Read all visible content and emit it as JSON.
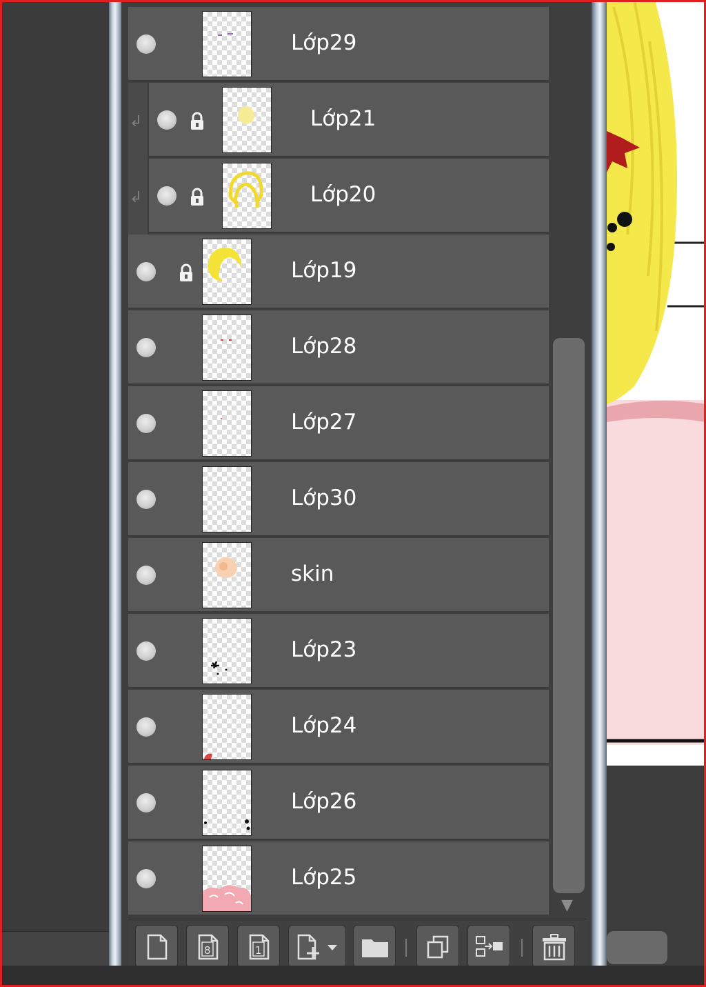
{
  "layers": [
    {
      "name": "Lớp29",
      "clipped": false,
      "locked": false,
      "thumb": "purple-marks"
    },
    {
      "name": "Lớp21",
      "clipped": true,
      "locked": true,
      "thumb": "yellow-blob"
    },
    {
      "name": "Lớp20",
      "clipped": true,
      "locked": true,
      "thumb": "yellow-hair-outline"
    },
    {
      "name": "Lớp19",
      "clipped": false,
      "locked": true,
      "thumb": "yellow-hair"
    },
    {
      "name": "Lớp28",
      "clipped": false,
      "locked": false,
      "thumb": "red-dots"
    },
    {
      "name": "Lớp27",
      "clipped": false,
      "locked": false,
      "thumb": "tiny-dot"
    },
    {
      "name": "Lớp30",
      "clipped": false,
      "locked": false,
      "thumb": "empty"
    },
    {
      "name": "skin",
      "clipped": false,
      "locked": false,
      "thumb": "skin-face"
    },
    {
      "name": "Lớp23",
      "clipped": false,
      "locked": false,
      "thumb": "black-splat"
    },
    {
      "name": "Lớp24",
      "clipped": false,
      "locked": false,
      "thumb": "red-corner"
    },
    {
      "name": "Lớp26",
      "clipped": false,
      "locked": false,
      "thumb": "black-dots"
    },
    {
      "name": "Lớp25",
      "clipped": false,
      "locked": false,
      "thumb": "pink-blobs"
    }
  ],
  "toolbar": {
    "buttons": [
      "new-layer-icon",
      "new-8bit-layer-icon",
      "new-1bit-layer-icon",
      "add-layer-dropdown-icon",
      "new-folder-icon",
      "duplicate-layer-icon",
      "merge-layer-icon",
      "delete-layer-icon"
    ]
  },
  "colors": {
    "row_bg": "#595959",
    "panel_bg": "#3e3e3e",
    "text": "#ffffff",
    "frame": "#e02020",
    "canvas_hair": "#f5e84a",
    "canvas_pink": "#f9dadd"
  }
}
